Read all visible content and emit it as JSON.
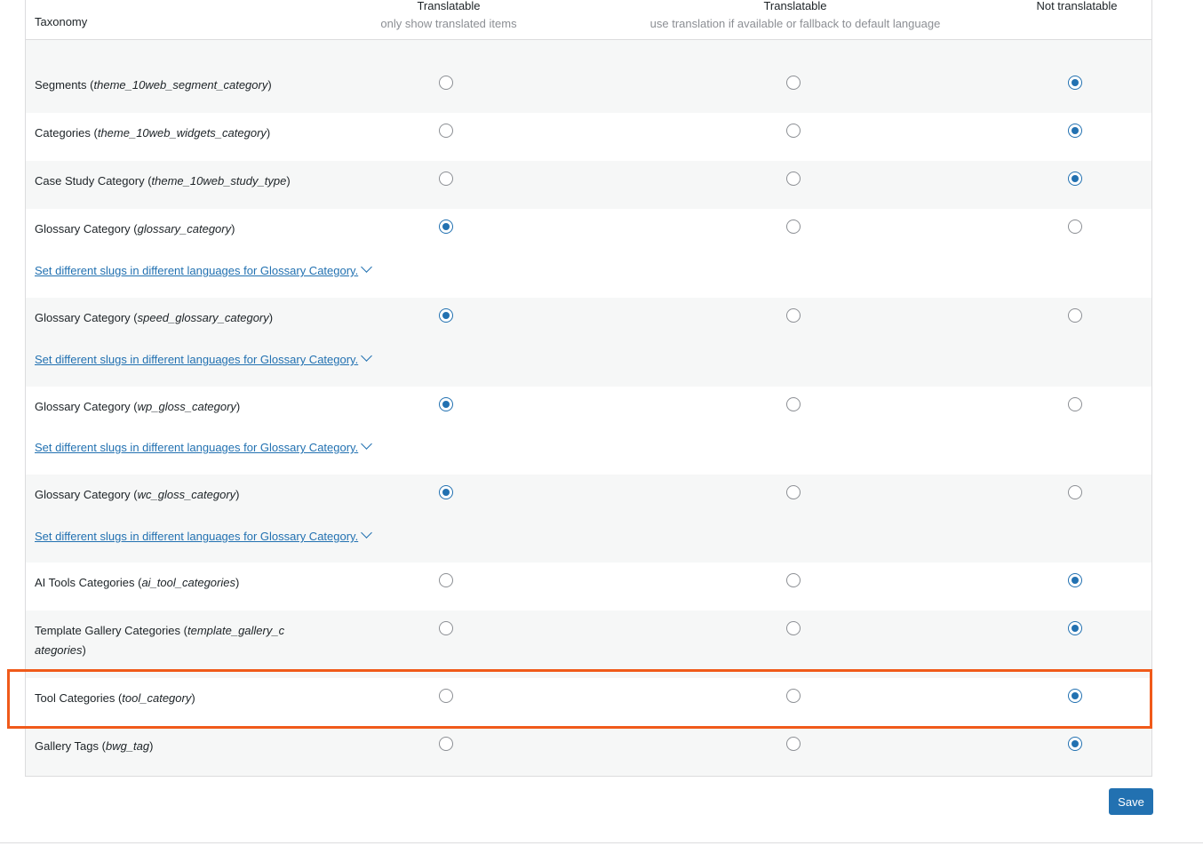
{
  "header": {
    "taxonomy_label": "Taxonomy",
    "col1_title": "Translatable",
    "col1_sub": "only show translated items",
    "col2_title": "Translatable",
    "col2_sub": "use translation if available or fallback to default language",
    "col3_title": "Not translatable"
  },
  "rows": [
    {
      "name": "Segments",
      "slug": "theme_10web_segment_category",
      "selected": 3
    },
    {
      "name": "Categories",
      "slug": "theme_10web_widgets_category",
      "selected": 3
    },
    {
      "name": "Case Study Category",
      "slug": "theme_10web_study_type",
      "selected": 3
    },
    {
      "name": "Glossary Category",
      "slug": "glossary_category",
      "selected": 1,
      "link": "Set different slugs in different languages for Glossary Category."
    },
    {
      "name": "Glossary Category",
      "slug": "speed_glossary_category",
      "selected": 1,
      "link": "Set different slugs in different languages for Glossary Category."
    },
    {
      "name": "Glossary Category",
      "slug": "wp_gloss_category",
      "selected": 1,
      "link": "Set different slugs in different languages for Glossary Category."
    },
    {
      "name": "Glossary Category",
      "slug": "wc_gloss_category",
      "selected": 1,
      "link": "Set different slugs in different languages for Glossary Category."
    },
    {
      "name": "AI Tools Categories",
      "slug": "ai_tool_categories",
      "selected": 3
    },
    {
      "name": "Template Gallery Categories",
      "slug": "template_gallery_categories",
      "selected": 3,
      "slug_wrap": [
        "template_gallery_c",
        "ategories"
      ]
    },
    {
      "name": "Tool Categories",
      "slug": "tool_category",
      "selected": 3,
      "highlighted": true
    },
    {
      "name": "Gallery Tags",
      "slug": "bwg_tag",
      "selected": 3
    }
  ],
  "save_label": "Save",
  "colors": {
    "accent": "#2271b1",
    "highlight": "#f05a1a",
    "alt_row": "#f6f7f7"
  }
}
